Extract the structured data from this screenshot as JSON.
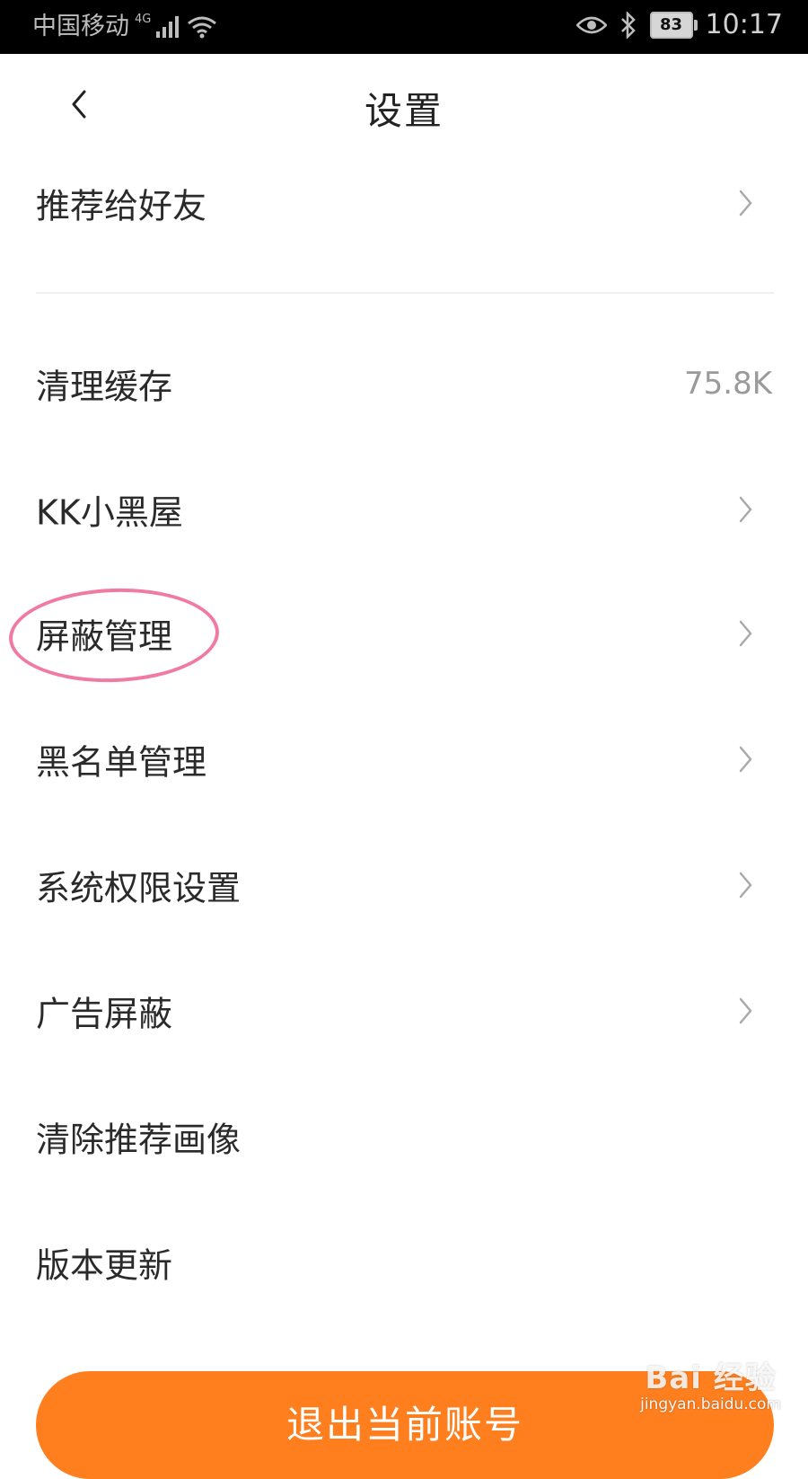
{
  "status_bar": {
    "carrier": "中国移动",
    "network": "4G",
    "battery": "83",
    "time": "10:17"
  },
  "header": {
    "title": "设置"
  },
  "settings": {
    "items": [
      {
        "label": "推荐给好友"
      },
      {
        "label": "清理缓存",
        "value": "75.8K"
      },
      {
        "label": "KK小黑屋"
      },
      {
        "label": "屏蔽管理"
      },
      {
        "label": "黑名单管理"
      },
      {
        "label": "系统权限设置"
      },
      {
        "label": "广告屏蔽"
      },
      {
        "label": "清除推荐画像"
      },
      {
        "label": "版本更新"
      }
    ]
  },
  "logout": {
    "label": "退出当前账号"
  },
  "watermark": {
    "logo": "Bai 经验",
    "url": "jingyan.baidu.com"
  },
  "colors": {
    "accent": "#ff7f1f",
    "highlight": "#f07aa0",
    "status_bar_bg": "#000000"
  }
}
